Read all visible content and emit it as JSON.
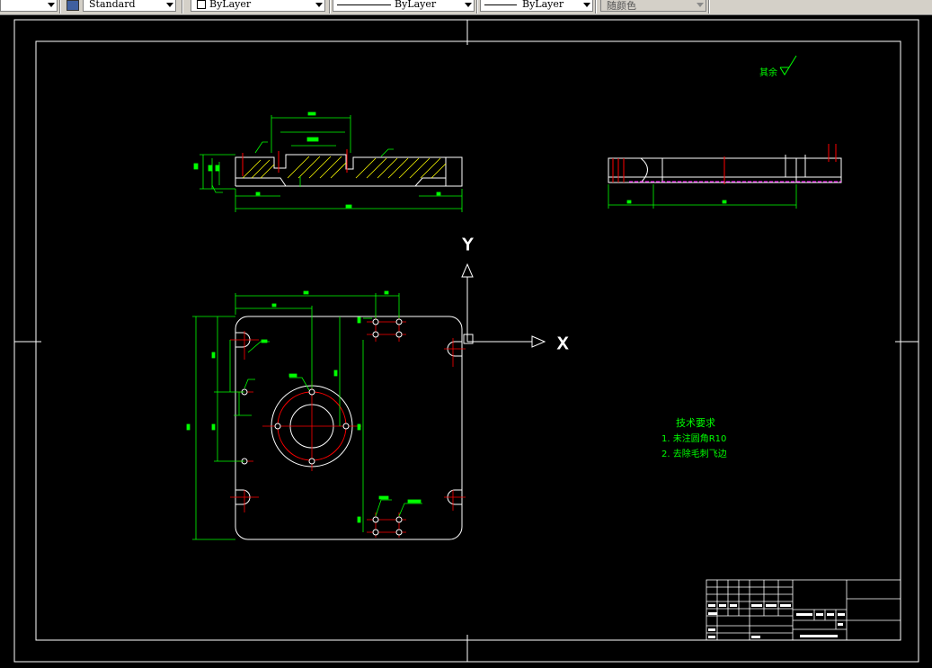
{
  "toolbar": {
    "dropdown_left_arrow": "",
    "text_style": "Standard",
    "layer_color": "ByLayer",
    "linetype": "ByLayer",
    "lineweight": "ByLayer",
    "plot_style": "随颜色"
  },
  "drawing": {
    "axis_x_label": "X",
    "axis_y_label": "Y",
    "roughness_label": "其余",
    "tech_req_title": "技术要求",
    "tech_req_items": [
      "1. 未注圆角R10",
      "2. 去除毛刺飞边"
    ]
  },
  "colors": {
    "background": "#000000",
    "frame": "#ffffff",
    "dimension": "#00ff00",
    "centerline": "#ff0000",
    "hatch": "#ffff00",
    "hidden": "#ff00ff",
    "text_green": "#00ff00",
    "toolbar_bg": "#d4d0c8"
  }
}
